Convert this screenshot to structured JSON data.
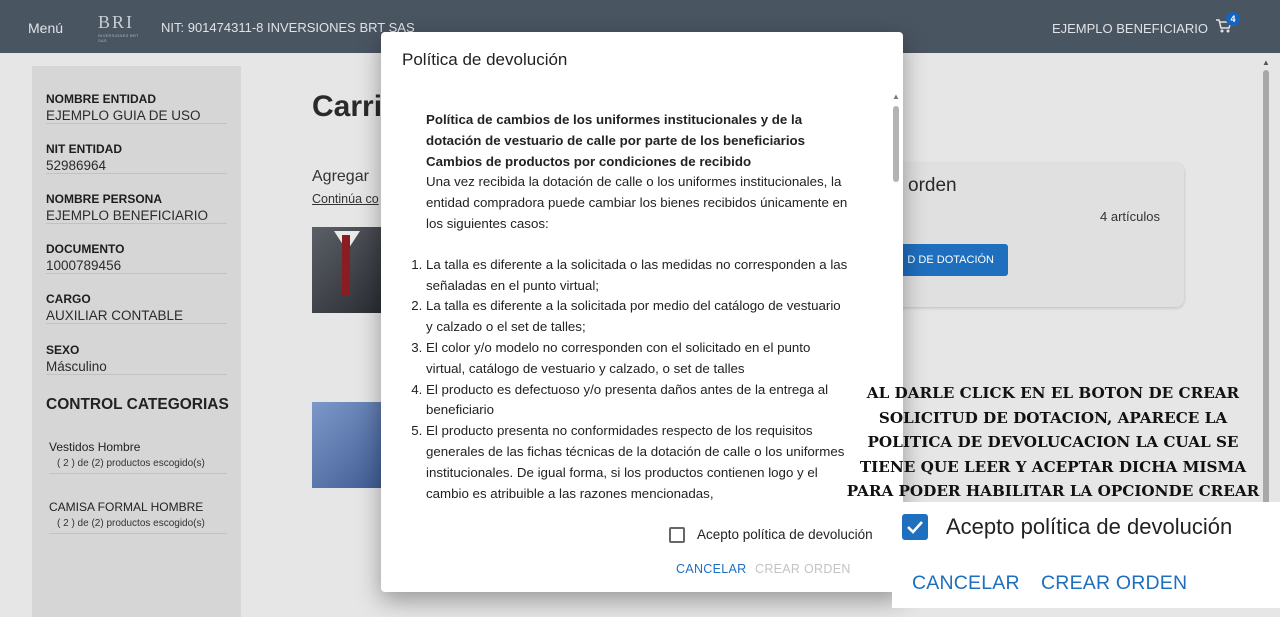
{
  "topbar": {
    "menu": "Menú",
    "logo_mark": "BRI",
    "logo_sub": "INVERSIONES BRT SAS",
    "nit": "NIT: 901474311-8   INVERSIONES BRT SAS",
    "user": "EJEMPLO BENEFICIARIO",
    "cart_count": "4"
  },
  "sidebar": {
    "fields": [
      {
        "label": "NOMBRE ENTIDAD",
        "value": "EJEMPLO GUIA DE USO"
      },
      {
        "label": "NIT ENTIDAD",
        "value": "52986964"
      },
      {
        "label": "NOMBRE PERSONA",
        "value": "EJEMPLO BENEFICIARIO"
      },
      {
        "label": "DOCUMENTO",
        "value": "1000789456"
      },
      {
        "label": "CARGO",
        "value": "AUXILIAR CONTABLE"
      },
      {
        "label": "SEXO",
        "value": "Másculino"
      }
    ],
    "control_title": "CONTROL CATEGORIAS",
    "categories": [
      {
        "name": "Vestidos Hombre",
        "count": "( 2 ) de (2) productos escogido(s)"
      },
      {
        "name": "CAMISA FORMAL HOMBRE",
        "count": "( 2 ) de (2) productos escogido(s)"
      }
    ]
  },
  "main": {
    "title": "Carri",
    "agregar": "Agregar",
    "continua": "Continúa co"
  },
  "order": {
    "title": "orden",
    "items": "4 artículos",
    "button": "D DE DOTACIÓN"
  },
  "dialog": {
    "title": "Política de devolución",
    "heading": "Política de cambios de los uniformes institucionales y de la dotación de vestuario de calle por parte de los beneficiarios",
    "subheading": "Cambios de productos por condiciones de recibido",
    "intro": "Una vez recibida la dotación de calle o los uniformes institucionales, la entidad compradora puede cambiar los bienes recibidos únicamente en los siguientes casos:",
    "items": [
      "La talla es diferente a la solicitada o las medidas no corresponden a las señaladas en el punto virtual;",
      "La talla es diferente a la solicitada por medio del catálogo de vestuario y calzado o el set de talles;",
      "El color y/o modelo no corresponden con el solicitado en el punto virtual, catálogo de vestuario y calzado, o set de talles",
      "El producto es defectuoso y/o presenta daños antes de la entrega al beneficiario",
      "El producto presenta no conformidades respecto de los requisitos generales de las fichas técnicas de la dotación de calle o los uniformes institucionales. De igual forma, si los productos contienen logo y el cambio es atribuible a las razones mencionadas,"
    ],
    "accept_label": "Acepto política de devolución",
    "accept_checked": false,
    "cancel": "CANCELAR",
    "create": "CREAR ORDEN"
  },
  "annotation": {
    "text": "AL DARLE CLICK EN EL BOTON DE CREAR SOLICITUD DE DOTACION, APARECE LA POLITICA DE DEVOLUCACION LA CUAL SE TIENE QUE LEER Y ACEPTAR DICHA MISMA PARA PODER HABILITAR LA OPCIONDE CREAR ORDEN: EJEMPLO"
  },
  "zoom": {
    "accept_label": "Acepto política de devolución",
    "accept_checked": true,
    "cancel": "CANCELAR",
    "create": "CREAR ORDEN"
  },
  "colors": {
    "topbar": "#4a5562",
    "accent": "#1f6fbf",
    "disabled": "#c3c3c3"
  }
}
